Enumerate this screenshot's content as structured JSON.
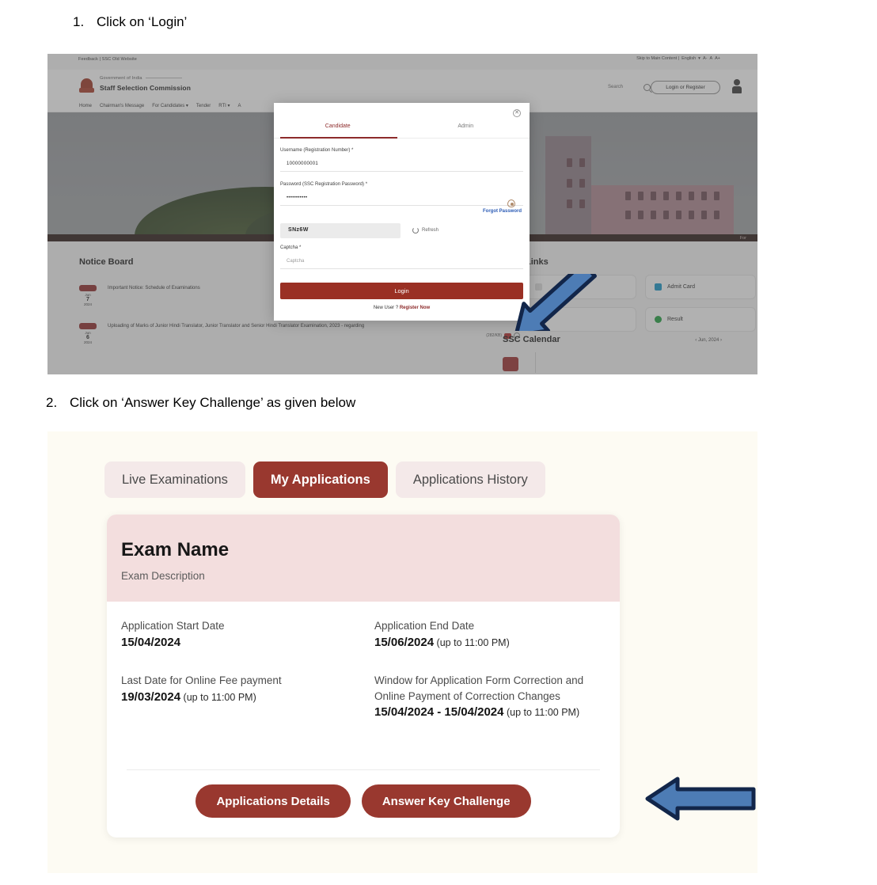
{
  "steps": [
    {
      "num": "1.",
      "text": "Click on ‘Login’"
    },
    {
      "num": "2.",
      "text": "Click on ‘Answer Key Challenge’ as given below"
    }
  ],
  "screenshot1": {
    "utility_bar": {
      "left": "Feedback | SSC Old Website",
      "skip": "Skip to Main Content |",
      "language": "English",
      "chevron": "▾",
      "font_small": "A-",
      "font_normal": "A",
      "font_large": "A+"
    },
    "masthead": {
      "government": "Government of India",
      "organisation": "Staff Selection Commission",
      "search_label": "Search",
      "login_register": "Login or Register"
    },
    "nav": [
      "Home",
      "Chairman's Message",
      "For Candidates ▾",
      "Tender",
      "RTI ▾",
      "A"
    ],
    "hero": {
      "corner_text": "For"
    },
    "notice_board": {
      "title": "Notice Board",
      "items": [
        {
          "badge": "New",
          "month": "Jun",
          "day": "7",
          "year": "2024",
          "text": "Important Notice: Schedule of Examinations",
          "meta": ""
        },
        {
          "badge": "New",
          "month": "Jun",
          "day": "6",
          "year": "2024",
          "text": "Uploading of Marks of Junior Hindi Translator, Junior Translator and Senior Hindi Translator Examination, 2023 - regarding",
          "meta": "(282/KB)"
        }
      ]
    },
    "links": {
      "title": "Links",
      "cards": [
        {
          "label": "",
          "color": "#d9d9d9"
        },
        {
          "label": "Admit Card",
          "color": "#1592c4"
        },
        {
          "label": "",
          "color": "#d9d9d9"
        },
        {
          "label": "Result",
          "color": "#1f9d3e"
        }
      ]
    },
    "calendar": {
      "title": "SSC Calendar",
      "prev": "‹",
      "period": "Jun, 2024",
      "next": "›"
    },
    "modal": {
      "close": "✕",
      "tabs": [
        {
          "label": "Candidate",
          "active": true
        },
        {
          "label": "Admin",
          "active": false
        }
      ],
      "username_label": "Username (Registration Number) *",
      "username_value": "10000000001",
      "password_label": "Password (SSC Registration Password) *",
      "password_value": "•••••••••••",
      "forgot_password": "Forgot Password",
      "captcha_image_text": "SNz6W",
      "refresh_label": "Refresh",
      "captcha_label": "Captcha *",
      "captcha_placeholder": "Captcha",
      "login_button": "Login",
      "new_user_text": "New User ?",
      "register_now": "Register Now"
    }
  },
  "screenshot2": {
    "tabs": [
      {
        "label": "Live Examinations",
        "active": false
      },
      {
        "label": "My Applications",
        "active": true
      },
      {
        "label": "Applications History",
        "active": false
      }
    ],
    "card": {
      "exam_name": "Exam Name",
      "exam_description": "Exam Description",
      "fields": [
        {
          "label": "Application Start Date",
          "value": "15/04/2024",
          "suffix": ""
        },
        {
          "label": "Application End Date",
          "value": "15/06/2024",
          "suffix": " (up to 11:00 PM)"
        },
        {
          "label": "Last Date for Online Fee payment",
          "value": "19/03/2024",
          "suffix": " (up to 11:00 PM)"
        },
        {
          "label": "Window for Application Form Correction and Online Payment of Correction Changes",
          "value": "15/04/2024 - 15/04/2024",
          "suffix": " (up to 11:00 PM)"
        }
      ],
      "buttons": [
        {
          "label": "Applications Details"
        },
        {
          "label": "Answer Key Challenge"
        }
      ]
    }
  },
  "colors": {
    "primary_maroon": "#99382f",
    "login_button": "#9a3024",
    "card_header_pink": "#f3dede",
    "tab_inactive": "#f4e9e9",
    "page_cream": "#fdfbf3",
    "arrow_blue": "#4d7cb5",
    "arrow_outline": "#12264a"
  },
  "annotations": {
    "arrow1": "callout-arrow pointing up-left at Login button",
    "arrow2": "callout-arrow pointing left at Answer Key Challenge button"
  }
}
